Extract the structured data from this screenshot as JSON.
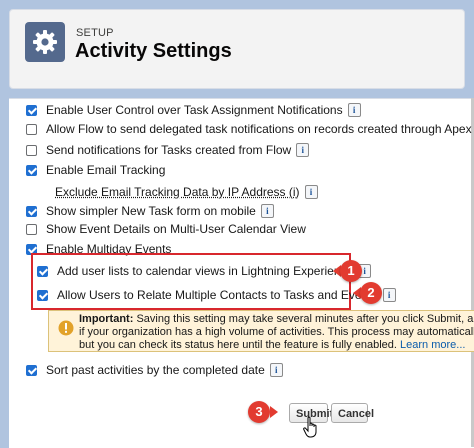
{
  "header": {
    "setup_label": "SETUP",
    "title": "Activity Settings",
    "icon": "gear-icon"
  },
  "settings": [
    {
      "label": "Enable User Control over Task Assignment Notifications",
      "checked": true,
      "info": true
    },
    {
      "label": "Allow Flow to send delegated task notifications on records created through Apex",
      "checked": false,
      "info": false
    },
    {
      "label": "Send notifications for Tasks created from Flow",
      "checked": false,
      "info": true
    },
    {
      "label": "Enable Email Tracking",
      "checked": true,
      "info": false
    },
    {
      "label": "Exclude Email Tracking Data by IP Address (i)",
      "checked": null,
      "info": true,
      "sub": true
    },
    {
      "label": "Show simpler New Task form on mobile",
      "checked": true,
      "info": true
    },
    {
      "label": "Show Event Details on Multi-User Calendar View",
      "checked": false,
      "info": false
    },
    {
      "label": "Enable Multiday Events",
      "checked": true,
      "info": false
    },
    {
      "label": "Add user lists to calendar views in Lightning Experience",
      "checked": true,
      "info": true
    },
    {
      "label": "Allow Users to Relate Multiple Contacts to Tasks and Events",
      "checked": true,
      "info": true
    },
    {
      "label": "Sort past activities by the completed date",
      "checked": true,
      "info": true
    }
  ],
  "notice": {
    "bold": "Important:",
    "line1": "Saving this setting may take several minutes after you click Submit, and the c",
    "line2": "if your organization has a high volume of activities. This process may automatically clear",
    "line3": "but you can check its status here until the feature is fully enabled.",
    "link": "Learn more..."
  },
  "callouts": [
    "1",
    "2",
    "3"
  ],
  "buttons": {
    "submit": "Submit",
    "cancel": "Cancel"
  },
  "colors": {
    "checkbox_checked": "#1f6fd1",
    "highlight": "#d8272d",
    "callout": "#e23b30",
    "notice_bg": "#fff3d9",
    "page_bg": "#b0c4df"
  }
}
